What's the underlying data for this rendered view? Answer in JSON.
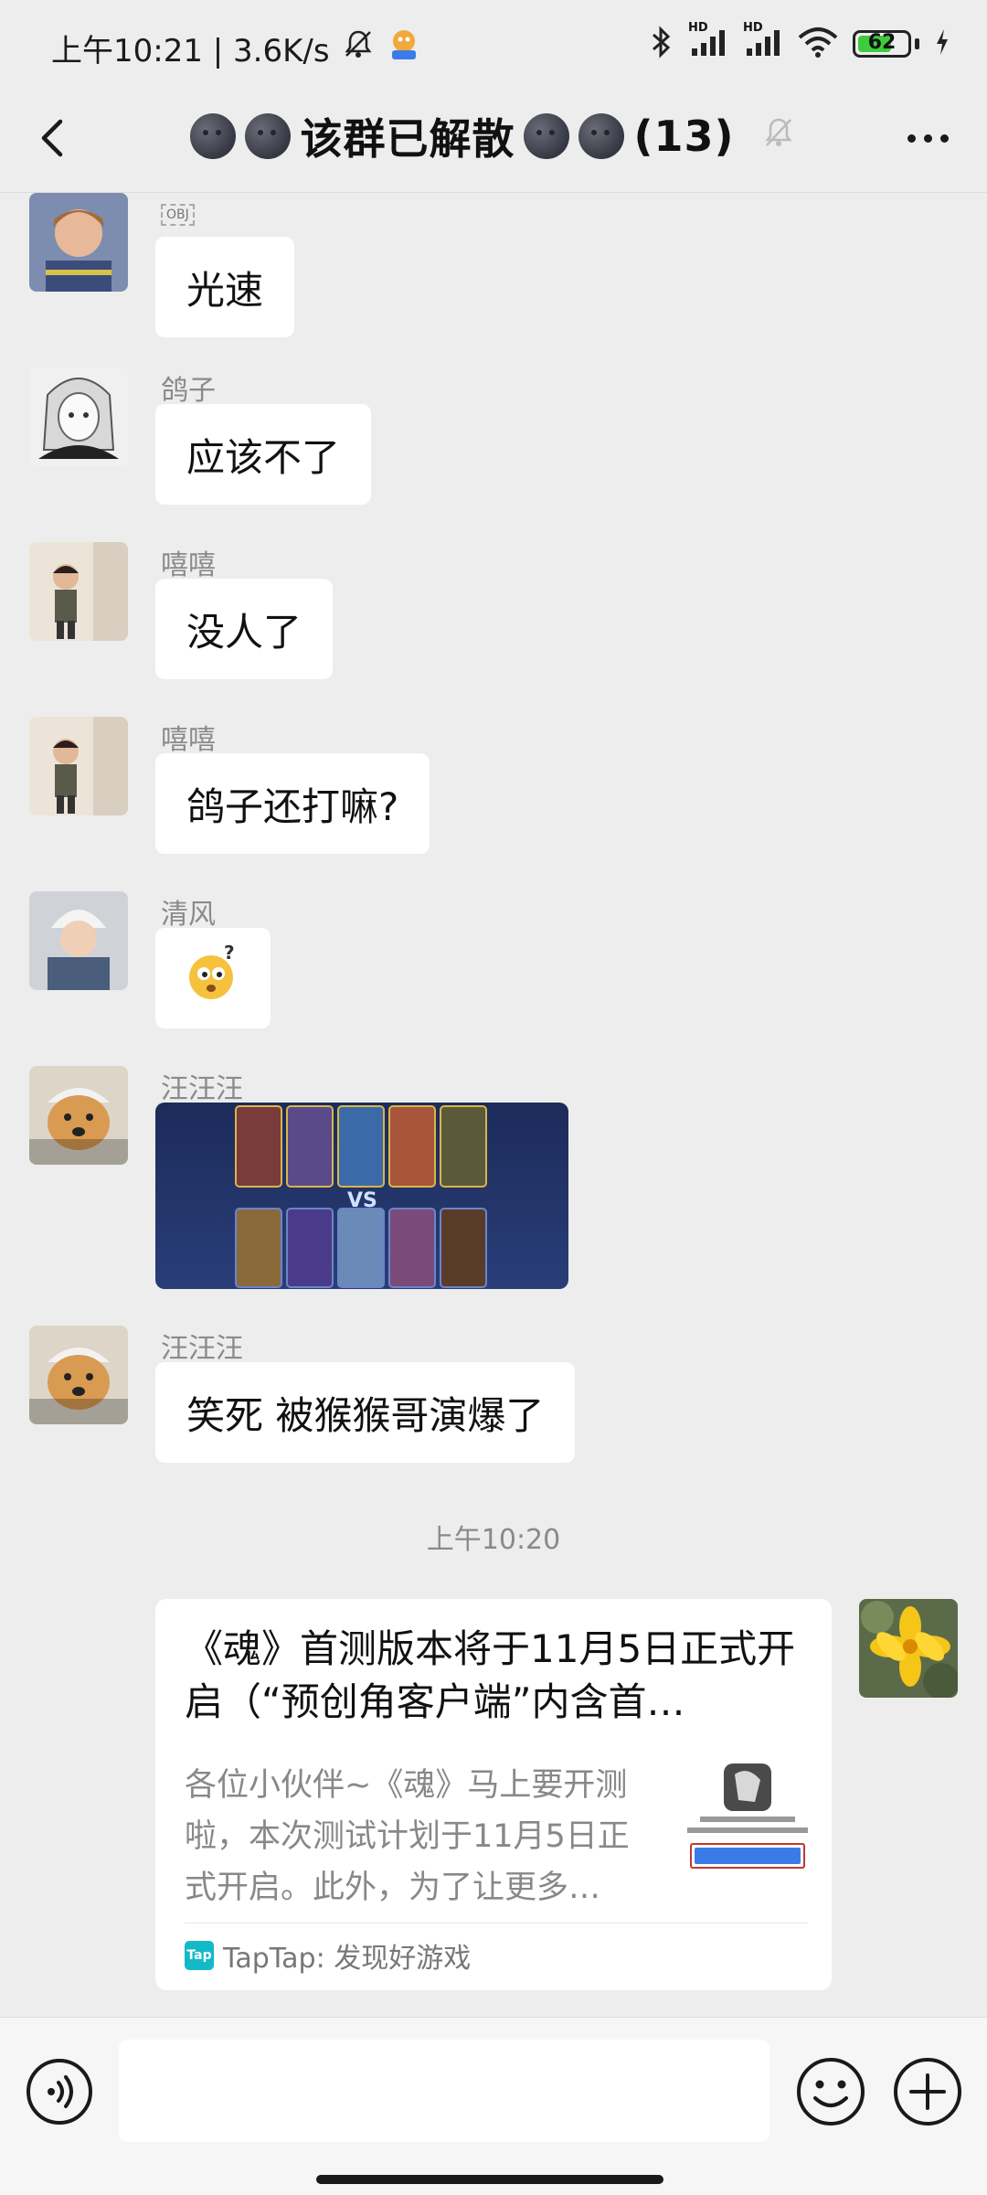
{
  "status_bar": {
    "time_speed": "上午10:21 | 3.6K/s",
    "hd1": "HD",
    "hd2": "HD",
    "battery": "62",
    "icons": [
      "dnd-off-icon",
      "app-notification-icon",
      "bluetooth-icon",
      "signal-icon",
      "signal-icon",
      "wifi-icon",
      "battery-icon",
      "charging-icon"
    ]
  },
  "header": {
    "title": "该群已解散",
    "count": "(13)",
    "icons": [
      "back-icon",
      "moon-emoji-icon",
      "mute-icon",
      "more-icon"
    ]
  },
  "messages": [
    {
      "sender": "",
      "tag": "OBJ",
      "text": "光速"
    },
    {
      "sender": "鸽子",
      "text": "应该不了"
    },
    {
      "sender": "嘻嘻",
      "text": "没人了"
    },
    {
      "sender": "嘻嘻",
      "text": "鸽子还打嘛?"
    },
    {
      "sender": "清风",
      "sticker": "confused-face-emoji"
    },
    {
      "sender": "汪汪汪",
      "image": "game-vs-screenshot"
    },
    {
      "sender": "汪汪汪",
      "text": "笑死 被猴猴哥演爆了"
    }
  ],
  "time_separator": "上午10:20",
  "link_card": {
    "title": "《魂》首测版本将于11月5日正式开启（“预创角客户端”内含首…",
    "description": "各位小伙伴~《魂》马上要开测啦，本次测试计划于11月5日正式开启。此外，为了让更多…",
    "source_badge": "Tap",
    "source": "TapTap: 发现好游戏"
  },
  "input": {
    "placeholder": ""
  },
  "colors": {
    "background": "#ededed",
    "bubble": "#ffffff",
    "meta_text": "#8a8a8a",
    "taptap": "#14b9c8"
  }
}
